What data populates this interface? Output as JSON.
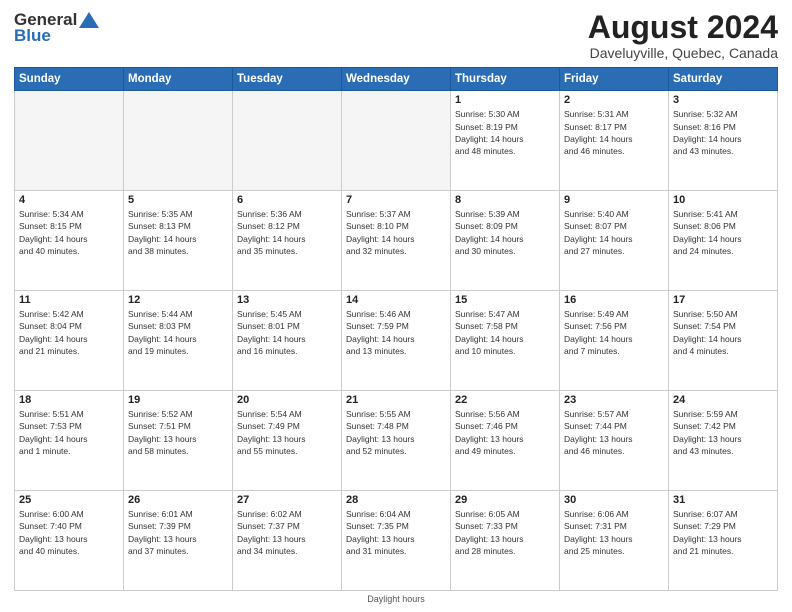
{
  "header": {
    "logo_general": "General",
    "logo_blue": "Blue",
    "month_year": "August 2024",
    "location": "Daveluyville, Quebec, Canada"
  },
  "days_of_week": [
    "Sunday",
    "Monday",
    "Tuesday",
    "Wednesday",
    "Thursday",
    "Friday",
    "Saturday"
  ],
  "footer": {
    "daylight_hours": "Daylight hours"
  },
  "weeks": [
    {
      "days": [
        {
          "num": "",
          "info": "",
          "empty": true
        },
        {
          "num": "",
          "info": "",
          "empty": true
        },
        {
          "num": "",
          "info": "",
          "empty": true
        },
        {
          "num": "",
          "info": "",
          "empty": true
        },
        {
          "num": "1",
          "info": "Sunrise: 5:30 AM\nSunset: 8:19 PM\nDaylight: 14 hours\nand 48 minutes.",
          "empty": false
        },
        {
          "num": "2",
          "info": "Sunrise: 5:31 AM\nSunset: 8:17 PM\nDaylight: 14 hours\nand 46 minutes.",
          "empty": false
        },
        {
          "num": "3",
          "info": "Sunrise: 5:32 AM\nSunset: 8:16 PM\nDaylight: 14 hours\nand 43 minutes.",
          "empty": false
        }
      ]
    },
    {
      "days": [
        {
          "num": "4",
          "info": "Sunrise: 5:34 AM\nSunset: 8:15 PM\nDaylight: 14 hours\nand 40 minutes.",
          "empty": false
        },
        {
          "num": "5",
          "info": "Sunrise: 5:35 AM\nSunset: 8:13 PM\nDaylight: 14 hours\nand 38 minutes.",
          "empty": false
        },
        {
          "num": "6",
          "info": "Sunrise: 5:36 AM\nSunset: 8:12 PM\nDaylight: 14 hours\nand 35 minutes.",
          "empty": false
        },
        {
          "num": "7",
          "info": "Sunrise: 5:37 AM\nSunset: 8:10 PM\nDaylight: 14 hours\nand 32 minutes.",
          "empty": false
        },
        {
          "num": "8",
          "info": "Sunrise: 5:39 AM\nSunset: 8:09 PM\nDaylight: 14 hours\nand 30 minutes.",
          "empty": false
        },
        {
          "num": "9",
          "info": "Sunrise: 5:40 AM\nSunset: 8:07 PM\nDaylight: 14 hours\nand 27 minutes.",
          "empty": false
        },
        {
          "num": "10",
          "info": "Sunrise: 5:41 AM\nSunset: 8:06 PM\nDaylight: 14 hours\nand 24 minutes.",
          "empty": false
        }
      ]
    },
    {
      "days": [
        {
          "num": "11",
          "info": "Sunrise: 5:42 AM\nSunset: 8:04 PM\nDaylight: 14 hours\nand 21 minutes.",
          "empty": false
        },
        {
          "num": "12",
          "info": "Sunrise: 5:44 AM\nSunset: 8:03 PM\nDaylight: 14 hours\nand 19 minutes.",
          "empty": false
        },
        {
          "num": "13",
          "info": "Sunrise: 5:45 AM\nSunset: 8:01 PM\nDaylight: 14 hours\nand 16 minutes.",
          "empty": false
        },
        {
          "num": "14",
          "info": "Sunrise: 5:46 AM\nSunset: 7:59 PM\nDaylight: 14 hours\nand 13 minutes.",
          "empty": false
        },
        {
          "num": "15",
          "info": "Sunrise: 5:47 AM\nSunset: 7:58 PM\nDaylight: 14 hours\nand 10 minutes.",
          "empty": false
        },
        {
          "num": "16",
          "info": "Sunrise: 5:49 AM\nSunset: 7:56 PM\nDaylight: 14 hours\nand 7 minutes.",
          "empty": false
        },
        {
          "num": "17",
          "info": "Sunrise: 5:50 AM\nSunset: 7:54 PM\nDaylight: 14 hours\nand 4 minutes.",
          "empty": false
        }
      ]
    },
    {
      "days": [
        {
          "num": "18",
          "info": "Sunrise: 5:51 AM\nSunset: 7:53 PM\nDaylight: 14 hours\nand 1 minute.",
          "empty": false
        },
        {
          "num": "19",
          "info": "Sunrise: 5:52 AM\nSunset: 7:51 PM\nDaylight: 13 hours\nand 58 minutes.",
          "empty": false
        },
        {
          "num": "20",
          "info": "Sunrise: 5:54 AM\nSunset: 7:49 PM\nDaylight: 13 hours\nand 55 minutes.",
          "empty": false
        },
        {
          "num": "21",
          "info": "Sunrise: 5:55 AM\nSunset: 7:48 PM\nDaylight: 13 hours\nand 52 minutes.",
          "empty": false
        },
        {
          "num": "22",
          "info": "Sunrise: 5:56 AM\nSunset: 7:46 PM\nDaylight: 13 hours\nand 49 minutes.",
          "empty": false
        },
        {
          "num": "23",
          "info": "Sunrise: 5:57 AM\nSunset: 7:44 PM\nDaylight: 13 hours\nand 46 minutes.",
          "empty": false
        },
        {
          "num": "24",
          "info": "Sunrise: 5:59 AM\nSunset: 7:42 PM\nDaylight: 13 hours\nand 43 minutes.",
          "empty": false
        }
      ]
    },
    {
      "days": [
        {
          "num": "25",
          "info": "Sunrise: 6:00 AM\nSunset: 7:40 PM\nDaylight: 13 hours\nand 40 minutes.",
          "empty": false
        },
        {
          "num": "26",
          "info": "Sunrise: 6:01 AM\nSunset: 7:39 PM\nDaylight: 13 hours\nand 37 minutes.",
          "empty": false
        },
        {
          "num": "27",
          "info": "Sunrise: 6:02 AM\nSunset: 7:37 PM\nDaylight: 13 hours\nand 34 minutes.",
          "empty": false
        },
        {
          "num": "28",
          "info": "Sunrise: 6:04 AM\nSunset: 7:35 PM\nDaylight: 13 hours\nand 31 minutes.",
          "empty": false
        },
        {
          "num": "29",
          "info": "Sunrise: 6:05 AM\nSunset: 7:33 PM\nDaylight: 13 hours\nand 28 minutes.",
          "empty": false
        },
        {
          "num": "30",
          "info": "Sunrise: 6:06 AM\nSunset: 7:31 PM\nDaylight: 13 hours\nand 25 minutes.",
          "empty": false
        },
        {
          "num": "31",
          "info": "Sunrise: 6:07 AM\nSunset: 7:29 PM\nDaylight: 13 hours\nand 21 minutes.",
          "empty": false
        }
      ]
    }
  ]
}
